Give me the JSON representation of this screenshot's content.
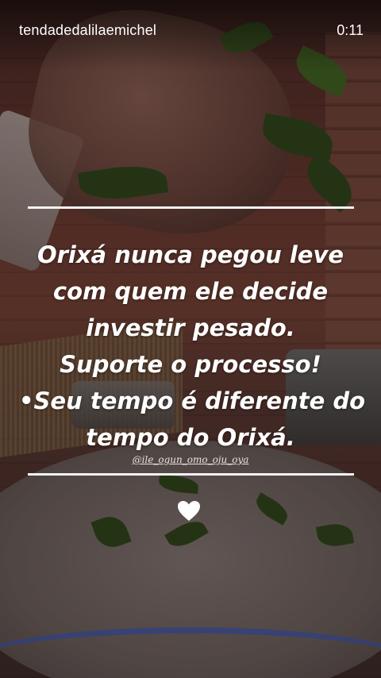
{
  "story": {
    "username": "tendadedalilaemichel",
    "timer": "0:11",
    "quote_lines": [
      "Orixá nunca pegou leve",
      "com quem ele decide",
      "investir pesado.",
      "Suporte o processo!",
      "•Seu tempo é diferente do",
      "tempo do Orixá."
    ],
    "handle": "@ile_ogun_omo_oju_oya",
    "sticker_icon": "white-heart-icon"
  },
  "colors": {
    "text": "#ffffff",
    "rule": "#f4f4f4"
  }
}
